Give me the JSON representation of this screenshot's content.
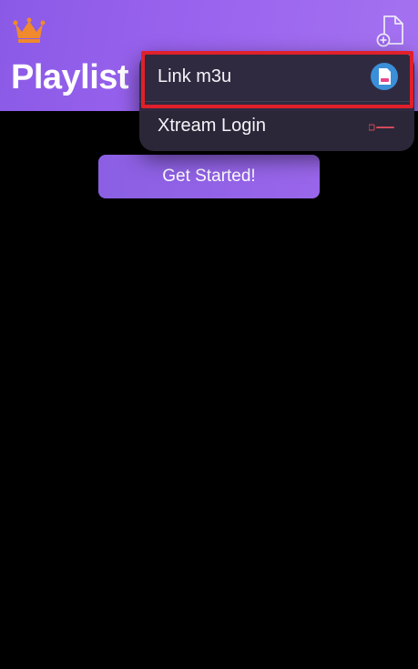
{
  "header": {
    "title": "Playlist",
    "crown_icon": "crown-icon",
    "add_icon": "file-add-icon"
  },
  "main": {
    "get_started_label": "Get Started!"
  },
  "menu": {
    "items": [
      {
        "label": "Link m3u",
        "icon": "m3u-file-icon"
      },
      {
        "label": "Xtream Login",
        "icon": "xtream-icon"
      }
    ]
  },
  "colors": {
    "header_gradient_start": "#8a5ae6",
    "header_gradient_end": "#a472f0",
    "accent_button": "#9966ea",
    "crown": "#f08a2c",
    "highlight_box": "#e0202a",
    "menu_bg": "#2c283a",
    "background": "#000000"
  }
}
